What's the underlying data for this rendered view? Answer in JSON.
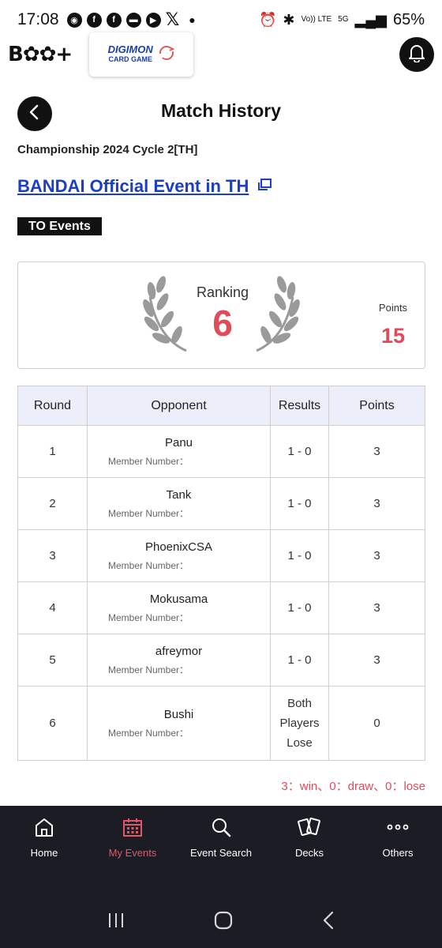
{
  "status_bar": {
    "time": "17:08",
    "battery": "65%",
    "network_top": "Vo)) LTE",
    "network_5g": "5G"
  },
  "header": {
    "brand": "B",
    "brand_suffix": "+",
    "game_logo_line1": "DIGIMON",
    "game_logo_line2": "CARD GAME"
  },
  "page": {
    "title": "Match History",
    "event_cycle": "Championship 2024 Cycle 2[TH]",
    "event_name": "BANDAI Official Event in TH",
    "event_type": "TO Events"
  },
  "ranking": {
    "label": "Ranking",
    "value": "6",
    "points_label": "Points",
    "points_value": "15"
  },
  "table": {
    "headers": [
      "Round",
      "Opponent",
      "Results",
      "Points"
    ],
    "member_label": "Member Number：",
    "rows": [
      {
        "round": "1",
        "opponent": "Panu",
        "result": "1 - 0",
        "points": "3"
      },
      {
        "round": "2",
        "opponent": "Tank",
        "result": "1 - 0",
        "points": "3"
      },
      {
        "round": "3",
        "opponent": "PhoenixCSA",
        "result": "1 - 0",
        "points": "3"
      },
      {
        "round": "4",
        "opponent": "Mokusama",
        "result": "1 - 0",
        "points": "3"
      },
      {
        "round": "5",
        "opponent": "afreymor",
        "result": "1 - 0",
        "points": "3"
      },
      {
        "round": "6",
        "opponent": "Bushi",
        "result_lines": [
          "Both",
          "Players",
          "Lose"
        ],
        "points": "0"
      }
    ]
  },
  "legend": "3：win、0：draw、0：lose",
  "bottom_nav": {
    "items": [
      {
        "label": "Home",
        "icon": "home-icon",
        "active": false
      },
      {
        "label": "My Events",
        "icon": "calendar-icon",
        "active": true
      },
      {
        "label": "Event Search",
        "icon": "search-icon",
        "active": false
      },
      {
        "label": "Decks",
        "icon": "cards-icon",
        "active": false
      },
      {
        "label": "Others",
        "icon": "more-icon",
        "active": false
      }
    ]
  },
  "colors": {
    "accent": "#e04b5a",
    "link": "#1a3fc4",
    "nav_bg": "#1c1c24"
  }
}
